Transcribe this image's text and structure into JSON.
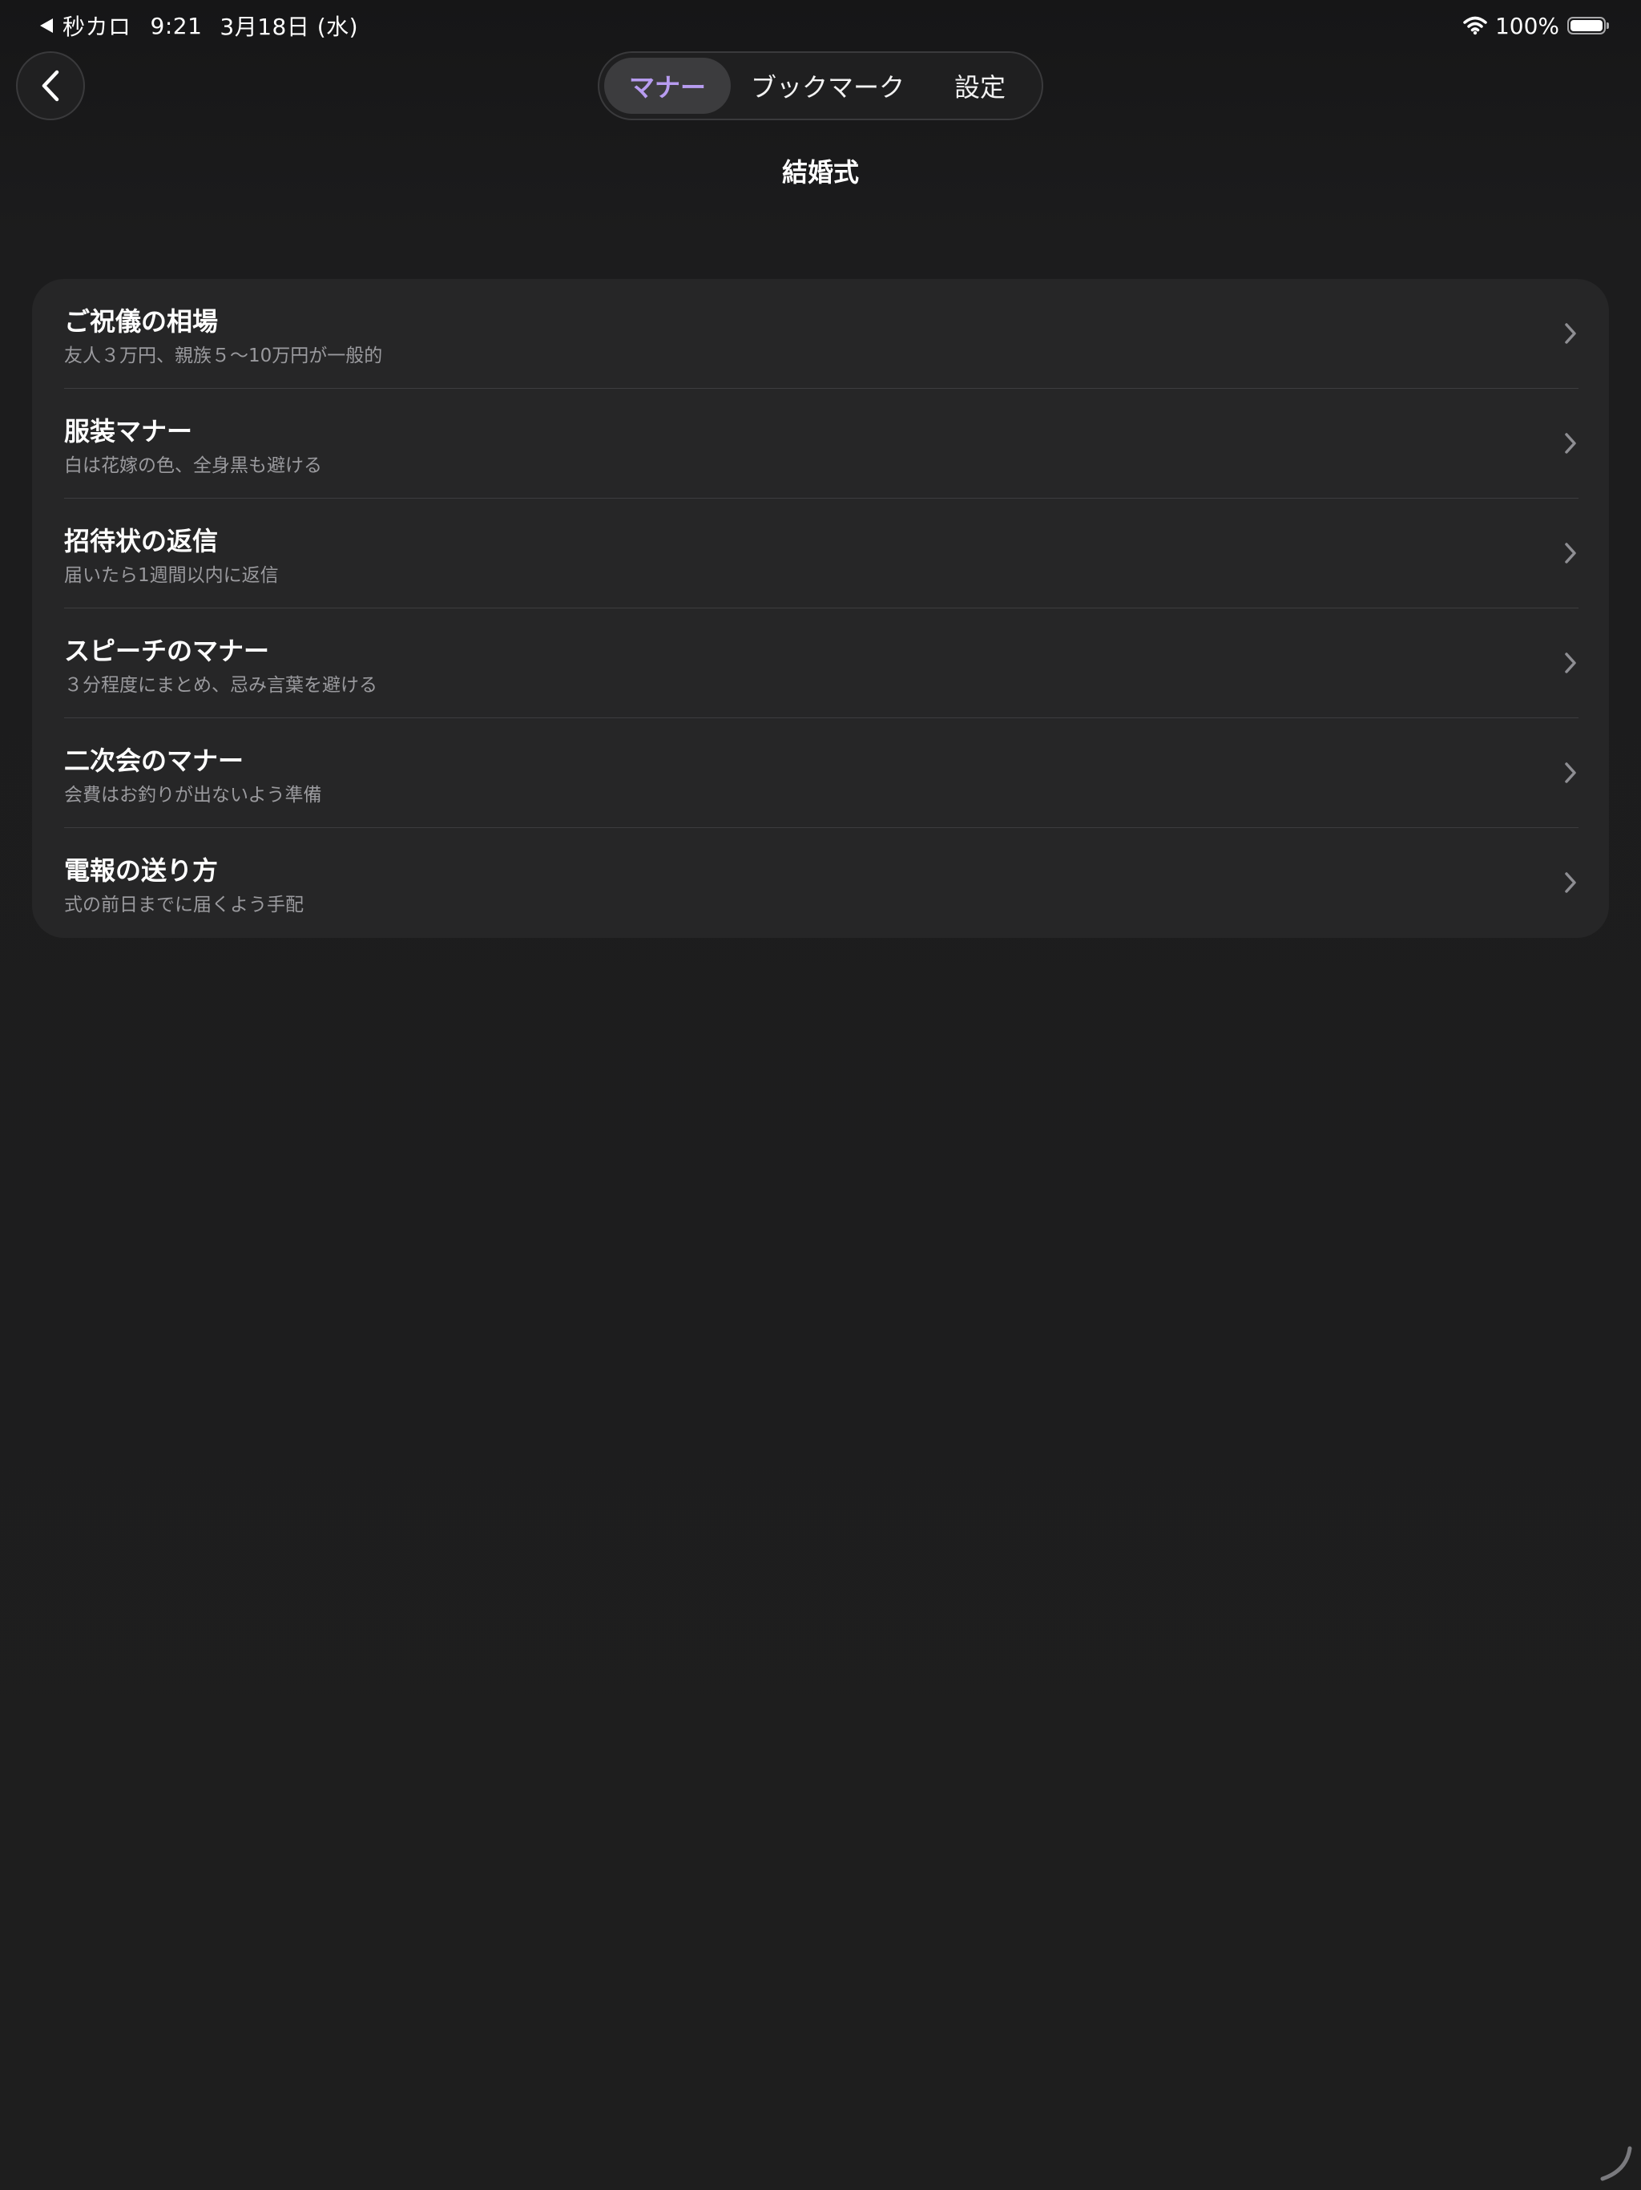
{
  "status_bar": {
    "back_app": "秒カロ",
    "time": "9:21",
    "date": "3月18日 (水)",
    "battery": "100%"
  },
  "tabs": [
    {
      "label": "マナー",
      "selected": true
    },
    {
      "label": "ブックマーク",
      "selected": false
    },
    {
      "label": "設定",
      "selected": false
    }
  ],
  "page": {
    "title": "結婚式"
  },
  "items": [
    {
      "title": "ご祝儀の相場",
      "subtitle": "友人３万円、親族５〜10万円が一般的"
    },
    {
      "title": "服装マナー",
      "subtitle": "白は花嫁の色、全身黒も避ける"
    },
    {
      "title": "招待状の返信",
      "subtitle": "届いたら1週間以内に返信"
    },
    {
      "title": "スピーチのマナー",
      "subtitle": "３分程度にまとめ、忌み言葉を避ける"
    },
    {
      "title": "二次会のマナー",
      "subtitle": "会費はお釣りが出ないよう準備"
    },
    {
      "title": "電報の送り方",
      "subtitle": "式の前日までに届くよう手配"
    }
  ],
  "colors": {
    "accent": "#b79cf0",
    "background": "#1c1c1d",
    "card": "#262627",
    "subtitle": "#9a9a9e"
  }
}
